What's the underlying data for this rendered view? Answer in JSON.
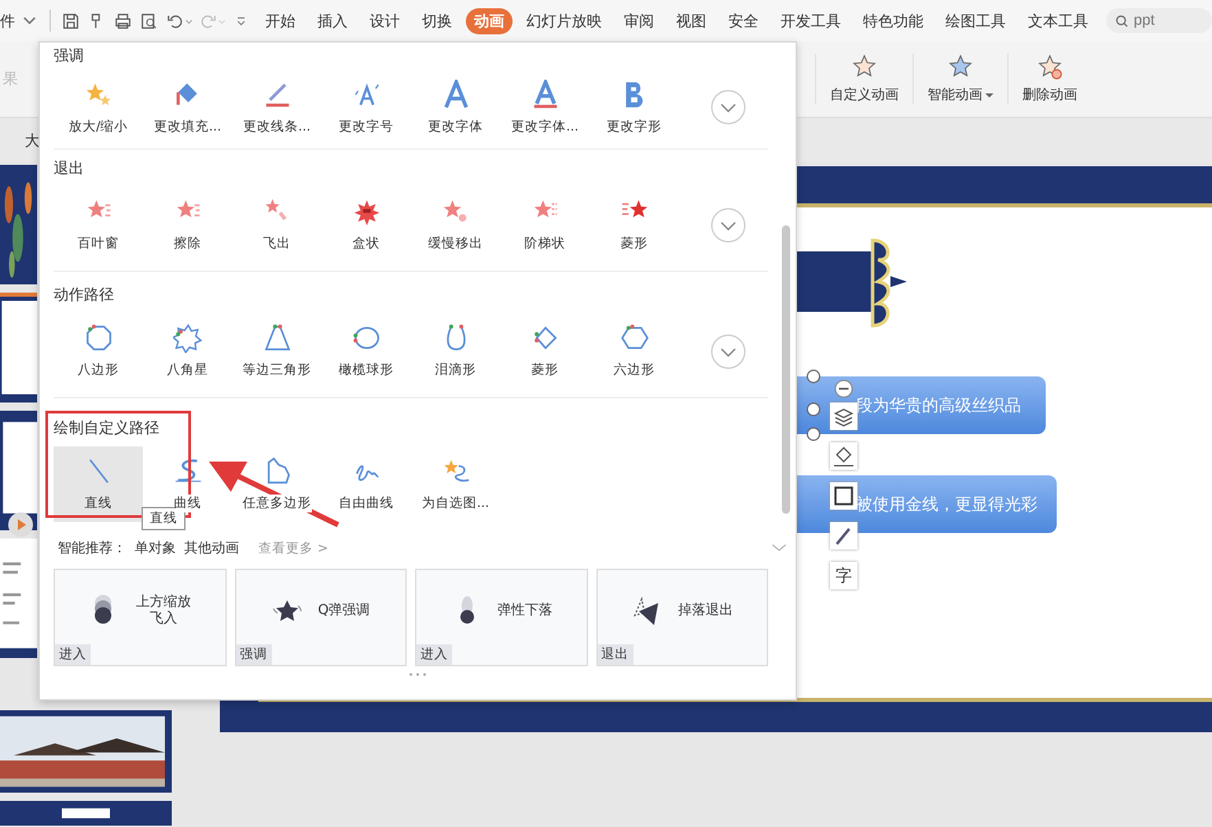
{
  "menu": {
    "file_tab": "件",
    "tabs": [
      {
        "label": "开始",
        "selected": false
      },
      {
        "label": "插入",
        "selected": false
      },
      {
        "label": "设计",
        "selected": false
      },
      {
        "label": "切换",
        "selected": false
      },
      {
        "label": "动画",
        "selected": true
      },
      {
        "label": "幻灯片放映",
        "selected": false
      },
      {
        "label": "审阅",
        "selected": false
      },
      {
        "label": "视图",
        "selected": false
      },
      {
        "label": "安全",
        "selected": false
      },
      {
        "label": "开发工具",
        "selected": false
      },
      {
        "label": "特色功能",
        "selected": false
      },
      {
        "label": "绘图工具",
        "selected": false
      },
      {
        "label": "文本工具",
        "selected": false
      }
    ],
    "search": {
      "placeholder": "ppt"
    }
  },
  "ribbon": {
    "cut_label": "果",
    "buttons": [
      {
        "label": "自定义动画",
        "dropdown": false
      },
      {
        "label": "智能动画",
        "dropdown": true
      },
      {
        "label": "删除动画",
        "dropdown": false
      }
    ]
  },
  "view_tab": "大",
  "panel": {
    "sections": [
      {
        "title": "强调",
        "expandable": true,
        "items": [
          {
            "label": "放大/缩小",
            "selected": false
          },
          {
            "label": "更改填充...",
            "selected": false
          },
          {
            "label": "更改线条...",
            "selected": false
          },
          {
            "label": "更改字号",
            "selected": false
          },
          {
            "label": "更改字体",
            "selected": false
          },
          {
            "label": "更改字体...",
            "selected": false
          },
          {
            "label": "更改字形",
            "selected": false
          }
        ]
      },
      {
        "title": "退出",
        "expandable": true,
        "items": [
          {
            "label": "百叶窗",
            "selected": false
          },
          {
            "label": "擦除",
            "selected": false
          },
          {
            "label": "飞出",
            "selected": false
          },
          {
            "label": "盒状",
            "selected": false
          },
          {
            "label": "缓慢移出",
            "selected": false
          },
          {
            "label": "阶梯状",
            "selected": false
          },
          {
            "label": "菱形",
            "selected": false
          }
        ]
      },
      {
        "title": "动作路径",
        "expandable": true,
        "items": [
          {
            "label": "八边形",
            "selected": false
          },
          {
            "label": "八角星",
            "selected": false
          },
          {
            "label": "等边三角形",
            "selected": false
          },
          {
            "label": "橄榄球形",
            "selected": false
          },
          {
            "label": "泪滴形",
            "selected": false
          },
          {
            "label": "菱形",
            "selected": false
          },
          {
            "label": "六边形",
            "selected": false
          }
        ]
      },
      {
        "title": "绘制自定义路径",
        "expandable": false,
        "items": [
          {
            "label": "直线",
            "selected": true
          },
          {
            "label": "曲线",
            "selected": false
          },
          {
            "label": "任意多边形",
            "selected": false
          },
          {
            "label": "自由曲线",
            "selected": false
          },
          {
            "label": "为自选图...",
            "selected": false
          }
        ]
      }
    ],
    "tooltip": "直线",
    "recommend": {
      "label": "智能推荐：",
      "filters": [
        "单对象",
        "其他动画"
      ],
      "more": "查看更多 >"
    },
    "cards": [
      {
        "title": "上方缩放飞入",
        "tag": "进入"
      },
      {
        "title": "Q弹强调",
        "tag": "强调"
      },
      {
        "title": "弹性下落",
        "tag": "进入"
      },
      {
        "title": "掉落退出",
        "tag": "退出"
      }
    ]
  },
  "slide": {
    "text_boxes": [
      "段为华贵的高级丝织品",
      "被使用金线，更显得光彩"
    ],
    "float_tool_text": "字"
  }
}
